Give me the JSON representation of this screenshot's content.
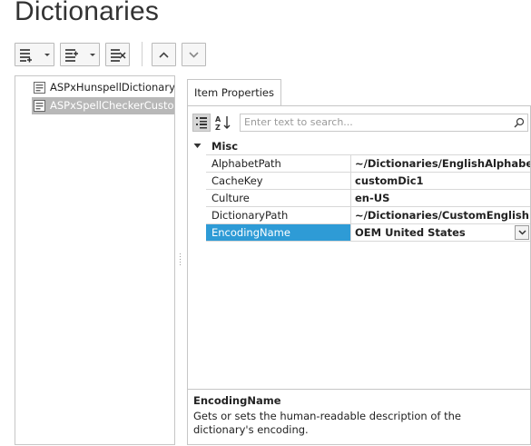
{
  "page": {
    "title": "Dictionaries"
  },
  "colors": {
    "selection_blue": "#2e9bd6",
    "tree_selection_gray": "#b8b8b8"
  },
  "toolbar": {
    "buttons": [
      {
        "icon": "add-item-icon",
        "has_dropdown": true
      },
      {
        "icon": "insert-item-icon",
        "has_dropdown": true
      },
      {
        "icon": "remove-item-icon",
        "has_dropdown": false
      },
      {
        "icon": "move-up-icon",
        "has_dropdown": false
      },
      {
        "icon": "move-down-icon",
        "has_dropdown": false
      }
    ]
  },
  "tree": {
    "items": [
      {
        "label": "ASPxHunspellDictionary",
        "icon": "dictionary-node-icon",
        "selected": false
      },
      {
        "label": "ASPxSpellCheckerCusto...",
        "icon": "dictionary-node-icon",
        "selected": true
      }
    ]
  },
  "properties": {
    "tab_label": "Item Properties",
    "toolbar": {
      "categorized_icon": "categorized-icon",
      "alphabetical_icon": "sort-az-icon"
    },
    "search": {
      "placeholder": "Enter text to search...",
      "icon": "search-icon"
    },
    "category": {
      "name": "Misc",
      "expanded": true
    },
    "rows": [
      {
        "name": "AlphabetPath",
        "value": "~/Dictionaries/EnglishAlphabet.txt",
        "selected": false
      },
      {
        "name": "CacheKey",
        "value": "customDic1",
        "selected": false
      },
      {
        "name": "Culture",
        "value": "en-US",
        "selected": false
      },
      {
        "name": "DictionaryPath",
        "value": "~/Dictionaries/CustomEnglish.dic",
        "selected": false
      },
      {
        "name": "EncodingName",
        "value": "OEM United States",
        "selected": true,
        "editor": "dropdown"
      }
    ],
    "description": {
      "title": "EncodingName",
      "text": "Gets or sets the human-readable description of the dictionary's encoding."
    }
  }
}
